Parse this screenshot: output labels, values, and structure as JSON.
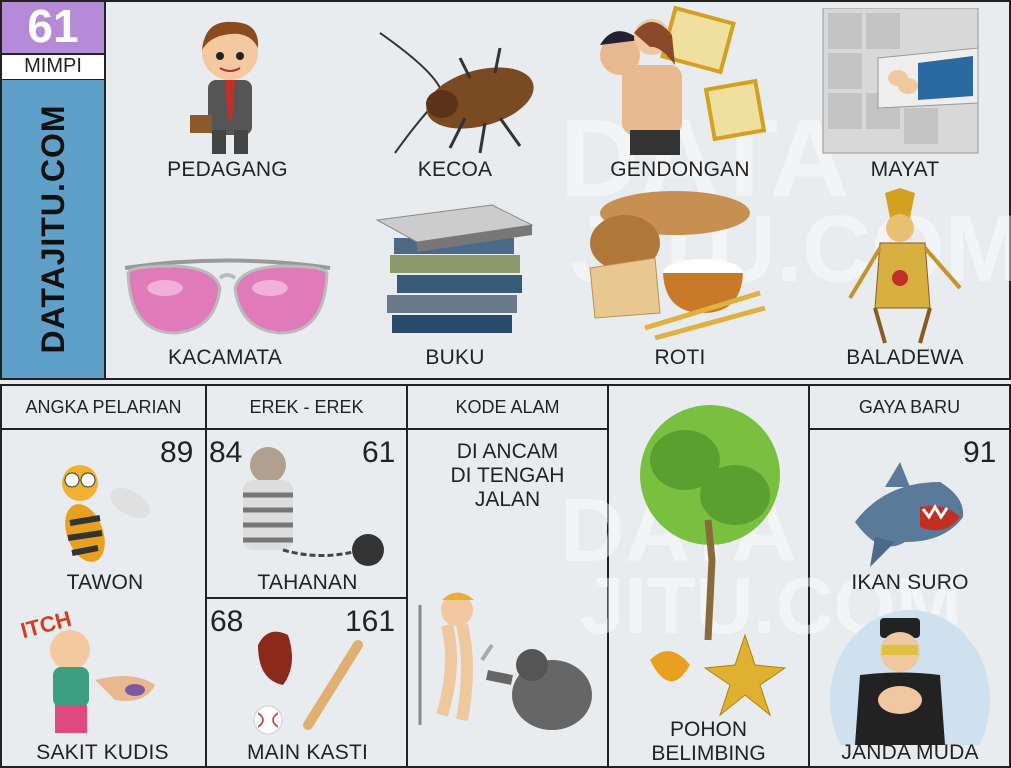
{
  "sidebar": {
    "number": "61",
    "subtitle": "MIMPI",
    "site": "DATAJITU.COM"
  },
  "watermark": {
    "line1": "DATA",
    "line2": "JITU.COM"
  },
  "top_items": [
    {
      "label": "PEDAGANG",
      "icon": "merchant-icon"
    },
    {
      "label": "KECOA",
      "icon": "cockroach-icon"
    },
    {
      "label": "GENDONGAN",
      "icon": "piggyback-icon"
    },
    {
      "label": "MAYAT",
      "icon": "corpse-icon"
    },
    {
      "label": "KACAMATA",
      "icon": "sunglasses-icon"
    },
    {
      "label": "BUKU",
      "icon": "books-icon"
    },
    {
      "label": "ROTI",
      "icon": "bread-icon"
    },
    {
      "label": "BALADEWA",
      "icon": "wayang-icon"
    }
  ],
  "headers": {
    "pelarian": "ANGKA PELARIAN",
    "erek": "EREK - EREK",
    "kode": "KODE ALAM",
    "gaya": "GAYA BARU"
  },
  "pelarian": [
    {
      "number": "89",
      "label": "TAWON"
    },
    {
      "label": "SAKIT KUDIS",
      "badge": "ITCH"
    }
  ],
  "erek": [
    {
      "num_left": "84",
      "num_right": "61",
      "label": "TAHANAN"
    },
    {
      "num_left": "68",
      "num_right": "161",
      "label": "MAIN KASTI"
    }
  ],
  "kode": {
    "line1": "DI ANCAM",
    "line2": "DI TENGAH",
    "line3": "JALAN"
  },
  "pohon": {
    "line1": "POHON",
    "line2": "BELIMBING"
  },
  "gaya": [
    {
      "number": "91",
      "label": "IKAN SURO"
    },
    {
      "label": "JANDA MUDA"
    }
  ],
  "colors": {
    "sidebar_blue": "#5fa0c8",
    "number_purple": "#b58ad6",
    "frame": "#222222"
  }
}
